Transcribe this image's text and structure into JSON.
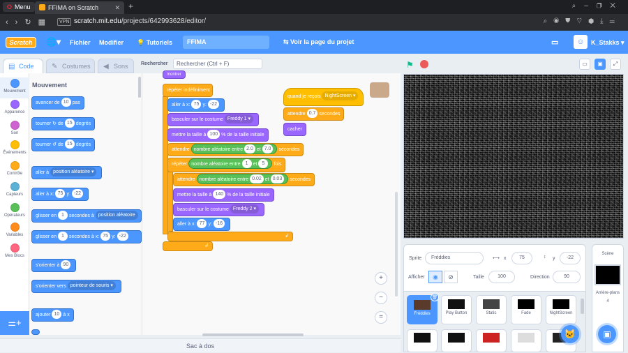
{
  "browser": {
    "menu_label": "Menu",
    "tab_title": "FFIMA on Scratch",
    "vpn_label": "VPN",
    "url_host": "scratch.mit.edu",
    "url_path": "/projects/642993628/editor/"
  },
  "menubar": {
    "logo": "Scratch",
    "file": "Fichier",
    "edit": "Modifier",
    "tutorials": "Tutoriels",
    "project_title": "FFIMA",
    "see_project": "Voir la page du projet",
    "username": "K_Stakks"
  },
  "editor_tabs": {
    "code": "Code",
    "costumes": "Costumes",
    "sounds": "Sons",
    "search_label": "Rechercher",
    "search_placeholder": "Rechercher (Ctrl + F)"
  },
  "categories": [
    {
      "label": "Mouvement",
      "color": "#4c97ff"
    },
    {
      "label": "Apparence",
      "color": "#9966ff"
    },
    {
      "label": "Son",
      "color": "#cf63cf"
    },
    {
      "label": "Événements",
      "color": "#ffbf00"
    },
    {
      "label": "Contrôle",
      "color": "#ffab19"
    },
    {
      "label": "Capteurs",
      "color": "#5cb1d6"
    },
    {
      "label": "Opérateurs",
      "color": "#59c059"
    },
    {
      "label": "Variables",
      "color": "#ff8c1a"
    },
    {
      "label": "Mes Blocs",
      "color": "#ff6680"
    }
  ],
  "palette": {
    "heading": "Mouvement",
    "advance": {
      "pre": "avancer de",
      "val": "10",
      "post": "pas"
    },
    "turn_right": {
      "pre": "tourner",
      "mid": "de",
      "val": "15",
      "post": "degrés"
    },
    "turn_left": {
      "pre": "tourner",
      "mid": "de",
      "val": "15",
      "post": "degrés"
    },
    "goto": {
      "pre": "aller à",
      "dd": "position aléatoire"
    },
    "goto_xy": {
      "pre": "aller à x:",
      "x": "75",
      "y_label": "y:",
      "y": "-22"
    },
    "glide_to": {
      "pre": "glisser en",
      "val": "1",
      "mid": "secondes à",
      "dd": "position aléatoire"
    },
    "glide_xy": {
      "pre": "glisser en",
      "val": "1",
      "mid": "secondes à x:",
      "x": "75",
      "y_label": "y:",
      "y": "-22"
    },
    "point_dir": {
      "pre": "s'orienter à",
      "val": "90"
    },
    "point_towards": {
      "pre": "s'orienter vers",
      "dd": "pointeur de souris"
    },
    "change_x": {
      "pre": "ajouter",
      "val": "10",
      "post": "à x"
    }
  },
  "script": {
    "top_block": "montrer",
    "forever": "répéter indéfiniment",
    "goto_xy": {
      "pre": "aller à x:",
      "x": "75",
      "y_label": "y:",
      "y": "-22"
    },
    "switch1": {
      "pre": "basculer sur le costume",
      "dd": "Freddy 1"
    },
    "size1": {
      "pre": "mettre la taille à",
      "val": "100",
      "post": "% de la taille initiale"
    },
    "wait1": {
      "pre": "attendre",
      "op": "nombre aléatoire entre",
      "a": "2.0",
      "and": "et",
      "b": "7.0",
      "post": "secondes"
    },
    "repeat": {
      "pre": "répéter",
      "op": "nombre aléatoire entre",
      "a": "1",
      "and": "et",
      "b": "5",
      "post": "fois"
    },
    "wait2": {
      "pre": "attendre",
      "op": "nombre aléatoire entre",
      "a": "0.02",
      "and": "et",
      "b": "0.03",
      "post": "secondes"
    },
    "size2": {
      "pre": "mettre la taille à",
      "val": "140",
      "post": "% de la taille initiale"
    },
    "switch2": {
      "pre": "basculer sur le costume",
      "dd": "Freddy 2"
    },
    "goto2": {
      "pre": "aller à x:",
      "x": "77",
      "y_label": "y:",
      "y": "-16"
    },
    "hat": {
      "pre": "quand je reçois",
      "dd": "NightScreen"
    },
    "wait3": {
      "pre": "attendre",
      "val": "0.7",
      "post": "secondes"
    },
    "hide": "cacher"
  },
  "backpack": "Sac à dos",
  "sprite_info": {
    "sprite_label": "Sprite",
    "sprite_name": "Fréddies",
    "x_label": "x",
    "x": "75",
    "y_label": "y",
    "y": "-22",
    "show_label": "Afficher",
    "size_label": "Taille",
    "size": "100",
    "direction_label": "Direction",
    "direction": "90"
  },
  "sprites": [
    {
      "name": "Fréddies",
      "color": "#5a3a2a"
    },
    {
      "name": "Play Button",
      "color": "#111111"
    },
    {
      "name": "Static",
      "color": "#444444"
    },
    {
      "name": "Fade",
      "color": "#000000"
    },
    {
      "name": "NightScreen",
      "color": "#000000"
    }
  ],
  "stage_panel": {
    "title": "Scène",
    "backdrops_label": "Arrière-plans",
    "backdrops_count": "4"
  }
}
